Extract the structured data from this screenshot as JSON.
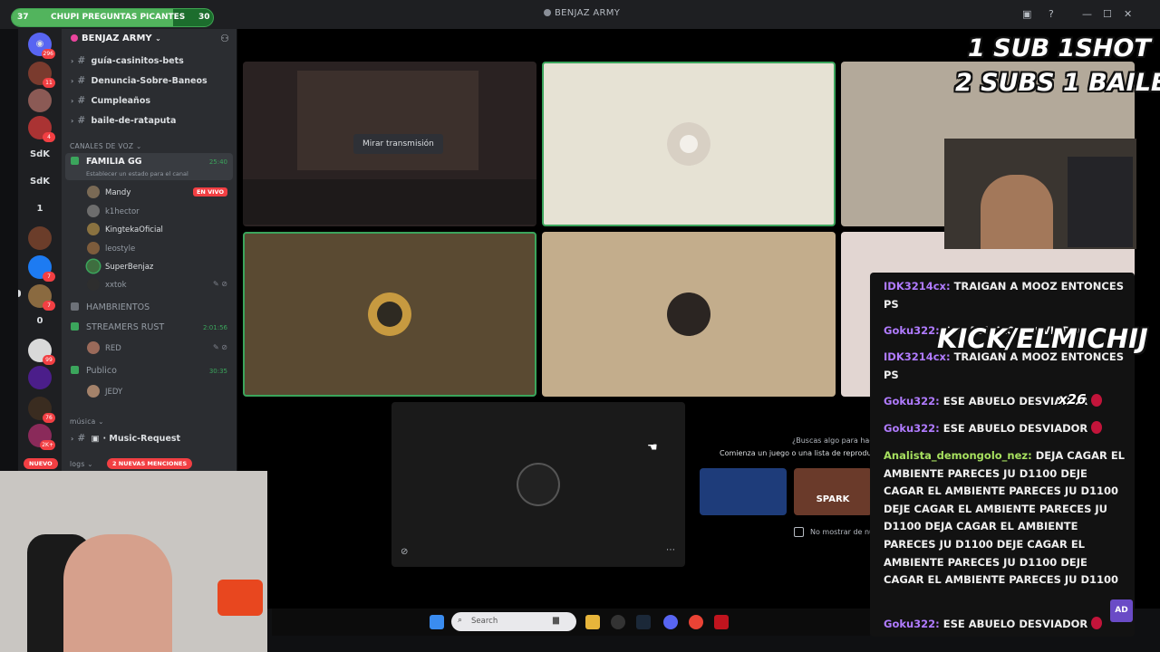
{
  "window": {
    "title": "BENJAZ ARMY"
  },
  "progress": {
    "left": "37",
    "label": "CHUPI PREGUNTAS PICANTES",
    "right": "30",
    "fraction": 0.8
  },
  "server_rail": {
    "badges": [
      "296",
      "11",
      "4",
      "7",
      "7",
      "99",
      "76",
      "2K+"
    ],
    "labels": [
      "SdK",
      "SdK",
      "1",
      "0"
    ],
    "new_label": "NUEVO"
  },
  "sidebar": {
    "server_name": "BENJAZ ARMY",
    "text_channels": [
      {
        "name": "guía-casinitos-bets"
      },
      {
        "name": "Denuncia-Sobre-Baneos"
      },
      {
        "name": "Cumpleaños"
      },
      {
        "name": "baile-de-rataputa"
      }
    ],
    "voice_category": "CANALES DE VOZ",
    "voice_channels": [
      {
        "name": "FAMILIA GG",
        "time": "25:40",
        "status": "Establecer un estado para el canal"
      },
      {
        "name": "HAMBRIENTOS",
        "time": ""
      },
      {
        "name": "STREAMERS RUST",
        "time": "2:01:56"
      },
      {
        "name": "Publico",
        "time": "30:35"
      }
    ],
    "members_familia": [
      {
        "name": "Mandy",
        "live": "EN VIVO"
      },
      {
        "name": "k1hector"
      },
      {
        "name": "KingtekaOficial"
      },
      {
        "name": "leostyle"
      },
      {
        "name": "SuperBenjaz"
      },
      {
        "name": "xxtok"
      }
    ],
    "members_rust": [
      {
        "name": "RED"
      }
    ],
    "members_publico": [
      {
        "name": "JEDY"
      }
    ],
    "music_category": "música",
    "music_channel": "Music-Request",
    "logs_category": "logs",
    "mentions_pill": "2 NUEVAS MENCIONES"
  },
  "call": {
    "watch_stream": "Mirar transmisión",
    "activity_title": "¿Buscas algo para hac",
    "activity_subtitle": "Comienza un juego o una lista de reproduc",
    "activity_card_label": "SPARK",
    "activity_checkbox": "No mostrar de nu"
  },
  "taskbar": {
    "search_placeholder": "Search"
  },
  "overlay": {
    "line1": "1 SUB  1SHOT",
    "line2": "2 SUBS 1 BAILE",
    "kick": "KICK/ELMICHIJ",
    "multiplier": "x26"
  },
  "chat": {
    "messages": [
      {
        "user": "IDK3214cx:",
        "color": "purple",
        "text": " TRAIGAN A MOOZ ENTONCES PS"
      },
      {
        "user": "Goku322:",
        "color": "purple",
        "text": " ESE ABUELO DESVIADOR"
      },
      {
        "user": "IDK3214cx:",
        "color": "purple",
        "text": " TRAIGAN A MOOZ ENTONCES PS"
      },
      {
        "user": "Goku322:",
        "color": "purple",
        "text": " ESE ABUELO DESVIADOR"
      },
      {
        "user": "Goku322:",
        "color": "purple",
        "text": " ESE ABUELO DESVIADOR"
      },
      {
        "user": "Analista_demongolo_nez:",
        "color": "green",
        "text": " DEJA CAGAR EL AMBIENTE PARECES JU D1100 DEJE CAGAR EL AMBIENTE PARECES JU D1100 DEJE CAGAR EL AMBIENTE PARECES JU D1100 DEJA CAGAR EL AMBIENTE PARECES JU D1100 DEJE CAGAR EL AMBIENTE PARECES JU D1100 DEJE CAGAR EL AMBIENTE PARECES JU D1100"
      },
      {
        "user": "Goku322:",
        "color": "purple",
        "text": " ESE ABUELO DESVIADOR"
      }
    ],
    "brand": "AD"
  }
}
